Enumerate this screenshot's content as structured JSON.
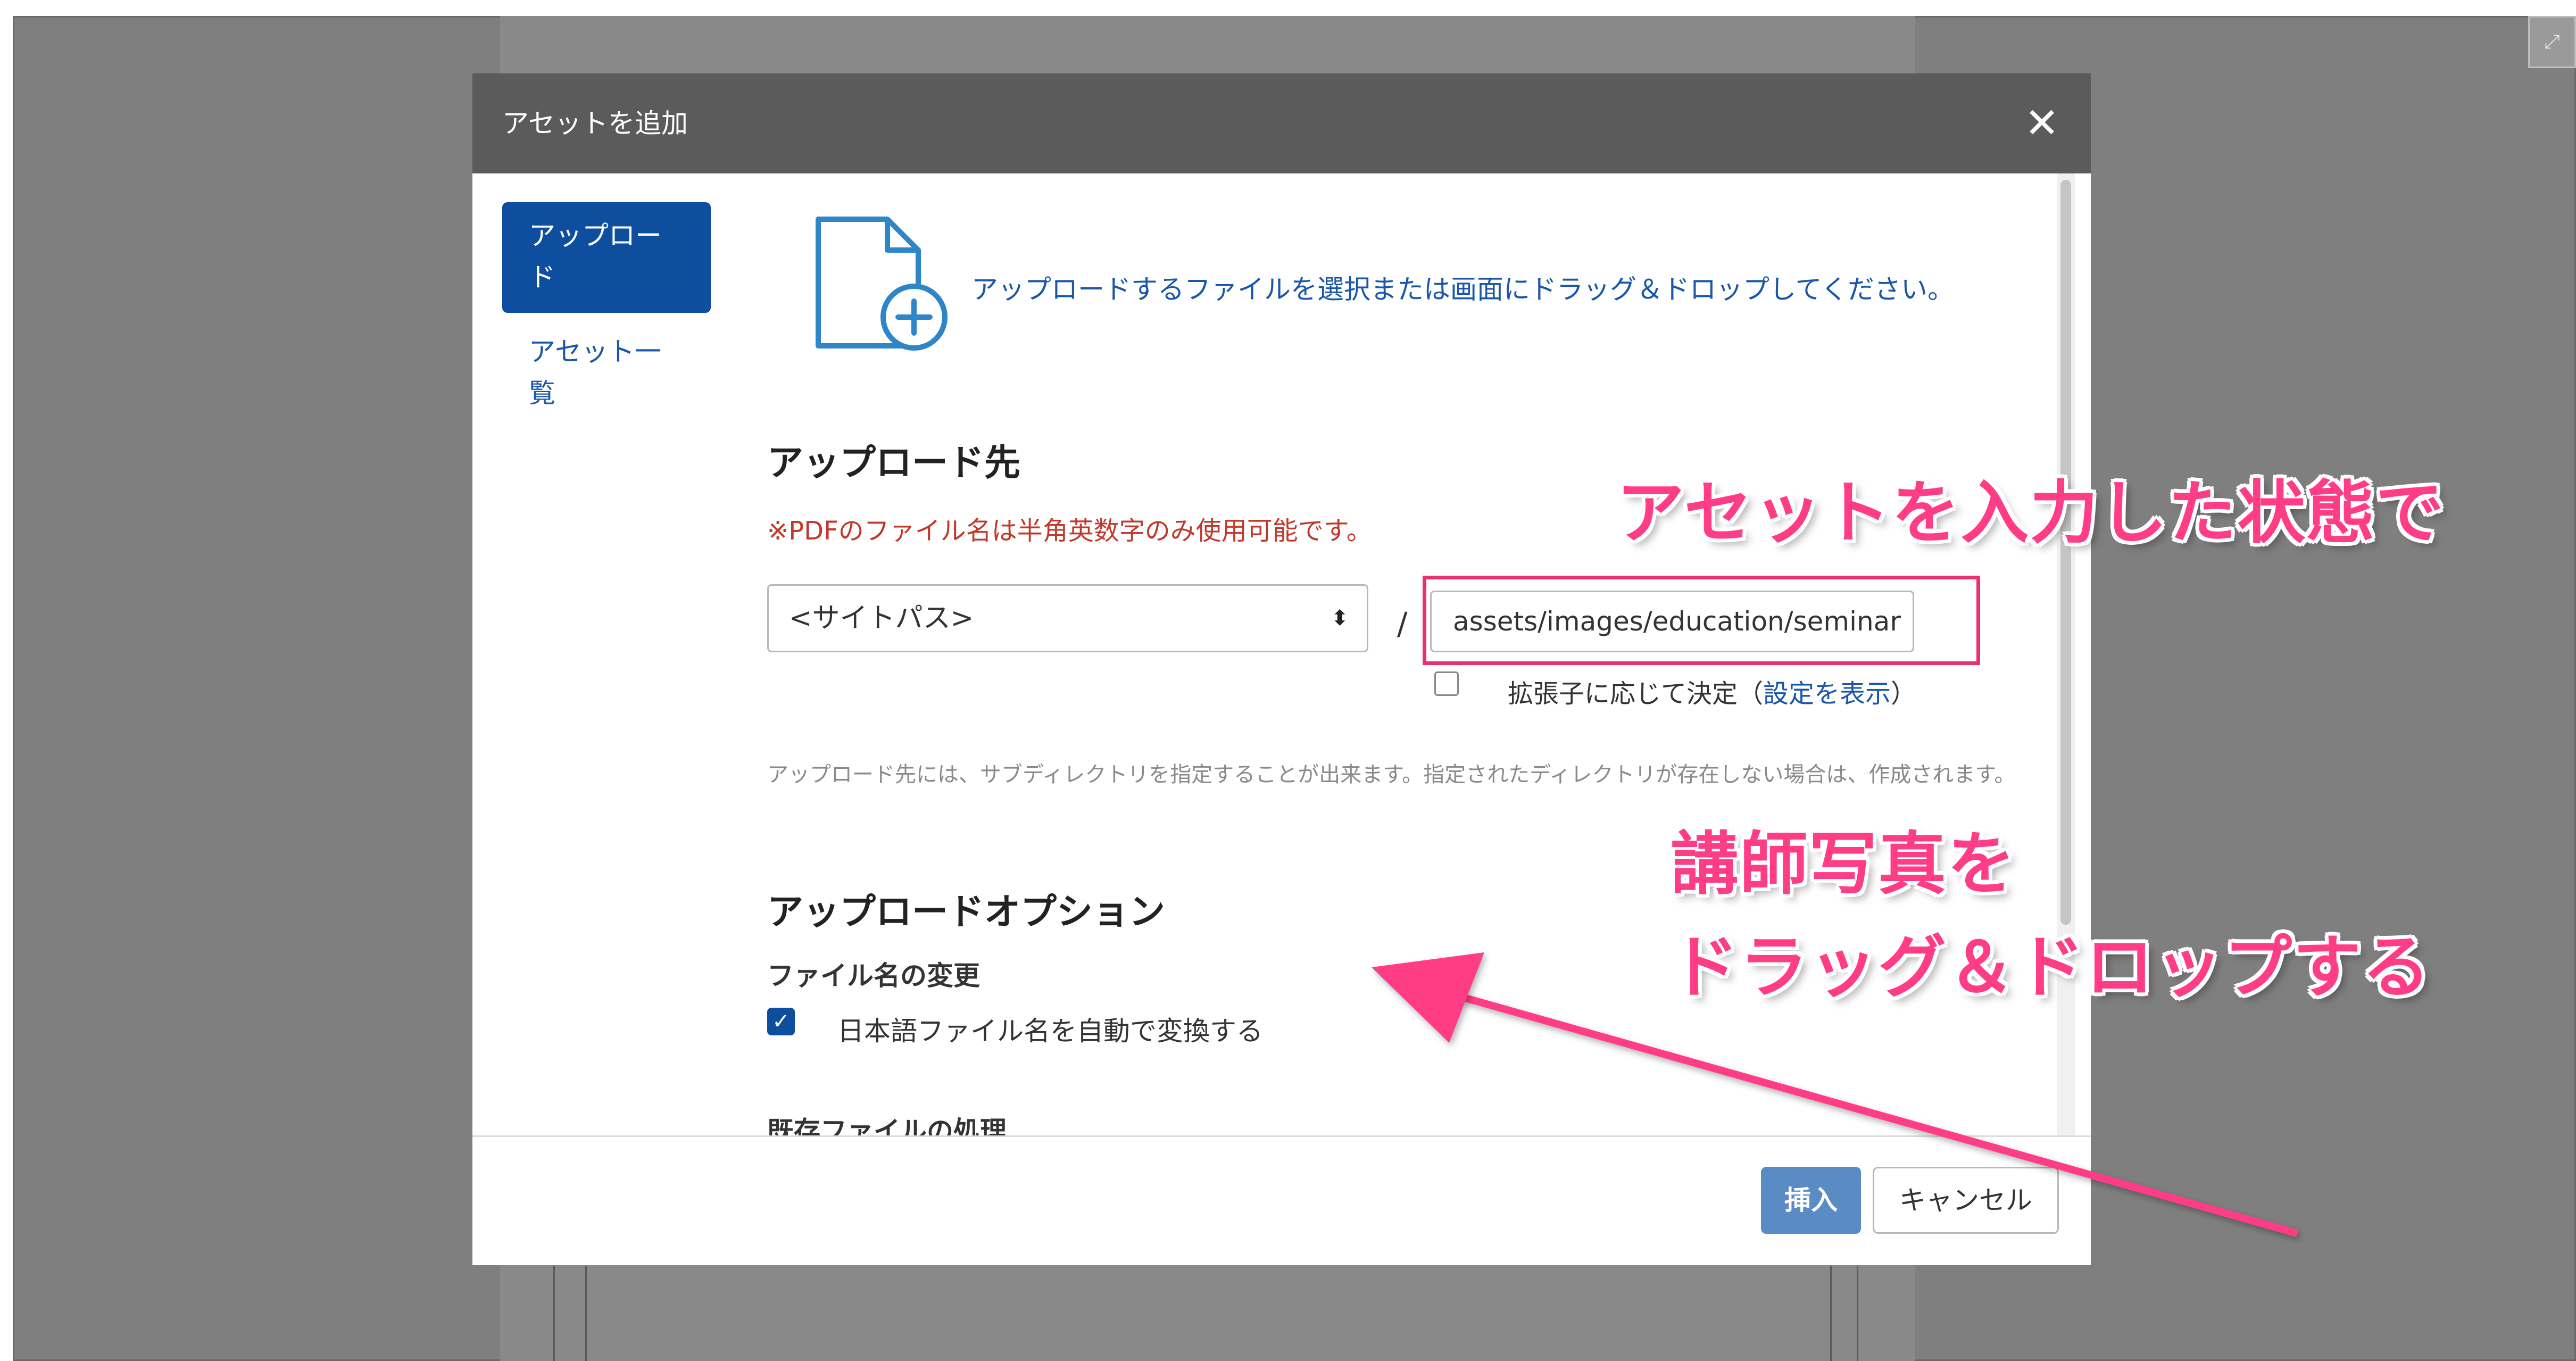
{
  "corner_icon": "expand-icon",
  "modal": {
    "title": "アセットを追加",
    "close_icon": "close-icon",
    "close_glyph": "✕"
  },
  "sidebar": {
    "items": [
      {
        "label": "アップロード",
        "active": true
      },
      {
        "label": "アセット一覧",
        "active": false
      }
    ]
  },
  "dropzone": {
    "icon": "file-add-icon",
    "text": "アップロードするファイルを選択または画面にドラッグ＆ドロップしてください。"
  },
  "destination": {
    "heading": "アップロード先",
    "warning": "※PDFのファイル名は半角英数字のみ使用可能です。",
    "site_select_value": "<サイトパス>",
    "separator": "/",
    "path_value": "assets/images/education/seminar",
    "ext_checkbox_checked": false,
    "ext_label_before": "拡張子に応じて決定（",
    "ext_link": "設定を表示",
    "ext_label_after": "）",
    "help_text": "アップロード先には、サブディレクトリを指定することが出来ます。指定されたディレクトリが存在しない場合は、作成されます。"
  },
  "options": {
    "heading": "アップロードオプション",
    "rename_heading": "ファイル名の変更",
    "rename_checkbox_checked": true,
    "rename_label": "日本語ファイル名を自動で変換する",
    "existing_heading": "既存ファイルの処理"
  },
  "footer": {
    "insert_label": "挿入",
    "cancel_label": "キャンセル"
  },
  "annotations": {
    "line1": "アセットを入力した状態で",
    "line2": "講師写真を",
    "line3": "ドラッグ＆ドロップする",
    "color": "#ff3c86"
  }
}
